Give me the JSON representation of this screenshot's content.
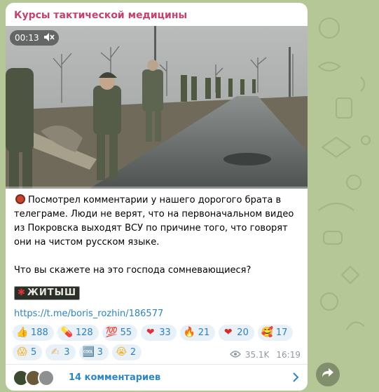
{
  "channel": {
    "title": "Курсы тактической медицины"
  },
  "video": {
    "timestamp": "00:13",
    "progress_fraction": 0.0
  },
  "post": {
    "paragraph1": "Посмотрел комментарии у нашего дорогого брата в телеграме. Люди не верят, что на первоначальном видео из Покровска выходят ВСУ по причине того, что говорят они на чистом русском языке.",
    "paragraph2": "Что вы скажете на это господа сомневающиеся?",
    "badge_text": "ЖИТЫШ",
    "link": "https://t.me/boris_rozhin/186577"
  },
  "reactions": [
    {
      "emoji": "thumbs-up-icon",
      "count": "188"
    },
    {
      "emoji": "pill-icon",
      "count": "128"
    },
    {
      "emoji": "hundred-icon",
      "count": "55"
    },
    {
      "emoji": "heart-icon",
      "count": "33"
    },
    {
      "emoji": "fire-icon",
      "count": "21"
    },
    {
      "emoji": "heart-fire-icon",
      "count": "20"
    },
    {
      "emoji": "hearts-face-icon",
      "count": "17"
    },
    {
      "emoji": "scream-face-icon",
      "count": "5"
    },
    {
      "emoji": "writing-hand-icon",
      "count": "3"
    },
    {
      "emoji": "cool-icon",
      "count": "3"
    },
    {
      "emoji": "crying-face-icon",
      "count": "2"
    }
  ],
  "meta": {
    "views": "35.1K",
    "time": "16:19"
  },
  "comments": {
    "label": "14 комментариев"
  },
  "colors": {
    "accent": "#2b86c5",
    "channel_name": "#c4426b",
    "background": "#b5c796"
  }
}
